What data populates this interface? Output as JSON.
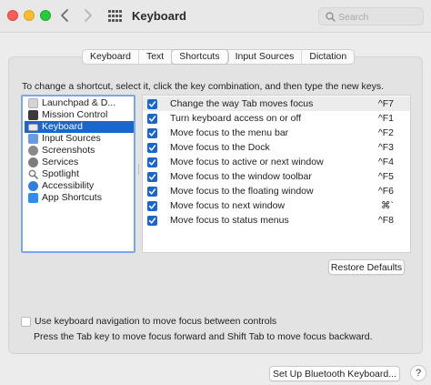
{
  "window": {
    "title": "Keyboard"
  },
  "toolbar": {
    "back_icon": "chevron-left",
    "forward_icon": "chevron-right",
    "grid_icon": "show-all-grid",
    "search_placeholder": "Search"
  },
  "tabs": [
    {
      "label": "Keyboard",
      "active": false
    },
    {
      "label": "Text",
      "active": false
    },
    {
      "label": "Shortcuts",
      "active": true
    },
    {
      "label": "Input Sources",
      "active": false
    },
    {
      "label": "Dictation",
      "active": false
    }
  ],
  "instruction": "To change a shortcut, select it, click the key combination, and then type the new keys.",
  "categories": [
    {
      "label": "Launchpad & D...",
      "icon": "launchpad-icon",
      "color": "#c9c9c9",
      "selected": false
    },
    {
      "label": "Mission Control",
      "icon": "mission-control-icon",
      "color": "#3a3a3a",
      "selected": false
    },
    {
      "label": "Keyboard",
      "icon": "keyboard-icon",
      "color": "#e8e8e8",
      "selected": true
    },
    {
      "label": "Input Sources",
      "icon": "input-sources-icon",
      "color": "#6a9be0",
      "selected": false
    },
    {
      "label": "Screenshots",
      "icon": "screenshots-icon",
      "color": "#8a8a8a",
      "selected": false
    },
    {
      "label": "Services",
      "icon": "services-gear-icon",
      "color": "#7d7d7d",
      "selected": false
    },
    {
      "label": "Spotlight",
      "icon": "spotlight-magnifier-icon",
      "color": "#9a9a9a",
      "selected": false
    },
    {
      "label": "Accessibility",
      "icon": "accessibility-icon",
      "color": "#2f7ee0",
      "selected": false
    },
    {
      "label": "App Shortcuts",
      "icon": "app-shortcuts-icon",
      "color": "#2e8ef0",
      "selected": false
    }
  ],
  "shortcuts": [
    {
      "label": "Change the way Tab moves focus",
      "key": "^F7",
      "checked": true,
      "highlighted": true
    },
    {
      "label": "Turn keyboard access on or off",
      "key": "^F1",
      "checked": true,
      "highlighted": false
    },
    {
      "label": "Move focus to the menu bar",
      "key": "^F2",
      "checked": true,
      "highlighted": false
    },
    {
      "label": "Move focus to the Dock",
      "key": "^F3",
      "checked": true,
      "highlighted": false
    },
    {
      "label": "Move focus to active or next window",
      "key": "^F4",
      "checked": true,
      "highlighted": false
    },
    {
      "label": "Move focus to the window toolbar",
      "key": "^F5",
      "checked": true,
      "highlighted": false
    },
    {
      "label": "Move focus to the floating window",
      "key": "^F6",
      "checked": true,
      "highlighted": false
    },
    {
      "label": "Move focus to next window",
      "key": "⌘`",
      "checked": true,
      "highlighted": false
    },
    {
      "label": "Move focus to status menus",
      "key": "^F8",
      "checked": true,
      "highlighted": false
    }
  ],
  "restore_button": "Restore Defaults",
  "keyboard_navigation": {
    "label": "Use keyboard navigation to move focus between controls",
    "checked": false,
    "help": "Press the Tab key to move focus forward and Shift Tab to move focus backward."
  },
  "bluetooth_button": "Set Up Bluetooth Keyboard...",
  "help_button": "?",
  "colors": {
    "accent": "#1a66cf",
    "focus_ring": "#7aa7e8"
  }
}
